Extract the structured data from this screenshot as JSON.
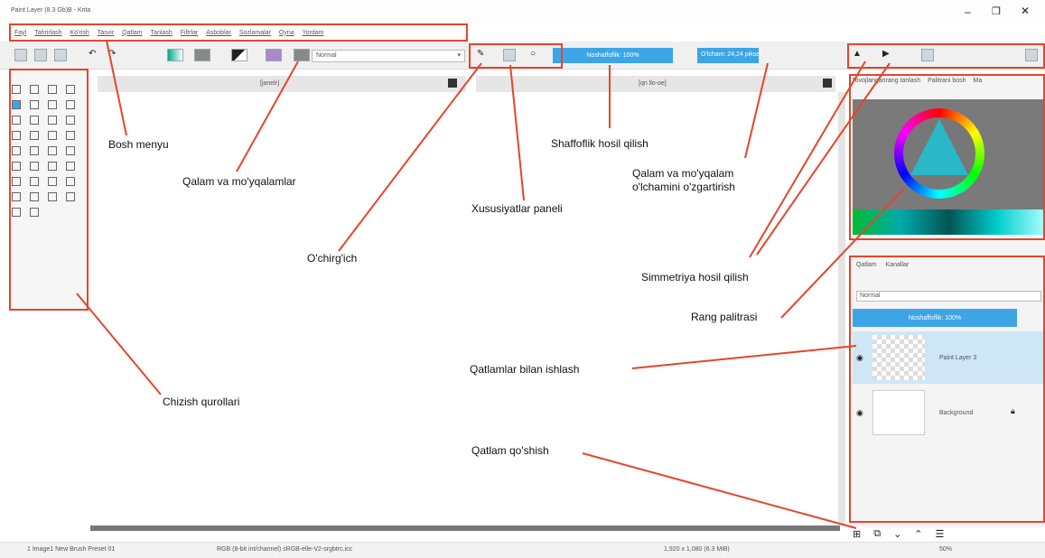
{
  "window": {
    "title": "Paint Layer (8.3 Gb)B - Krita"
  },
  "menu": [
    "Fayl",
    "Tahrirlash",
    "Ko'rish",
    "Tasvir",
    "Qatlam",
    "Tanlash",
    "Filtrlar",
    "Asboblar",
    "Sozlamalar",
    "Oyna",
    "Yordam"
  ],
  "toolbar": {
    "blend_mode": "Normal",
    "opacity": "Noshaffoflik: 100%",
    "size": "O'lcham: 24,24 piksel"
  },
  "tabs": {
    "left": "[janelr]",
    "right": "[qn llo-oe]"
  },
  "right_panel": {
    "tab1": "Rivojlanganrang tanlash",
    "tab2": "Palitrani bosh",
    "tab3": "Ma",
    "layers_tab": "Qatlam",
    "layers_tab2": "Kanallar",
    "blend": "Normal",
    "opacity": "Noshaffoflik: 100%",
    "layer1": "Paint Layer 3",
    "layer2": "Background"
  },
  "callouts": {
    "bosh": "Bosh menyu",
    "qalam": "Qalam va mo'yqalamlar",
    "ochirgich": "O'chirg'ich",
    "xususiyat": "Xususiyatlar paneli",
    "shaffof": "Shaffoflik hosil qilish",
    "olcham1": "Qalam va mo'yqalam",
    "olcham2": "o'lchamini o'zgartirish",
    "simmetriya": "Simmetriya hosil qilish",
    "rang": "Rang palitrasi",
    "qatlamlar": "Qatlamlar bilan ishlash",
    "chizish": "Chizish qurollari",
    "qoshish": "Qatlam qo'shish"
  },
  "status": {
    "left": "1 Image1 New Brush Preset 01",
    "mid": "RGB (8-bit int/channel) sRGB-elle-V2-srgbtrc.icc",
    "right": "1,920 x 1,080 (6.3 MiB)",
    "zoom": "50%"
  },
  "colors": {
    "accent": "#3da5e6",
    "callout_red": "#e6452b"
  }
}
